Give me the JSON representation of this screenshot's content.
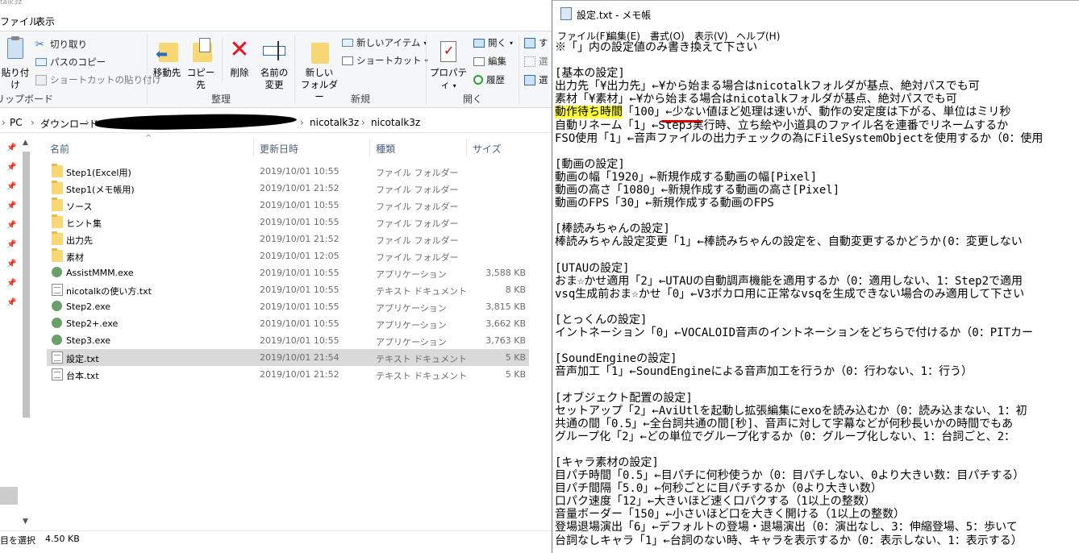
{
  "explorer": {
    "title_fragment": "talk3z",
    "tabs": [
      "ファイル",
      "表示"
    ],
    "ribbon": {
      "clipboard": {
        "pin_label": "貼り付け",
        "cut": "切り取り",
        "copy_path": "パスのコピー",
        "paste_shortcut": "ショートカットの貼り付け",
        "group": "リップボード"
      },
      "organize": {
        "move_to": "移動先",
        "copy_to": "コピー先",
        "delete": "削除",
        "rename_line1": "名前の",
        "rename_line2": "変更",
        "group": "整理"
      },
      "new": {
        "new_folder_line1": "新しい",
        "new_folder_line2": "フォルダー",
        "new_item": "新しいアイテム",
        "shortcut": "ショートカット",
        "group": "新規"
      },
      "open": {
        "properties": "プロパティ",
        "open": "開く",
        "edit": "編集",
        "history": "履歴",
        "group": "開く"
      },
      "select": {
        "sel1": "す",
        "sel2": "選",
        "sel3": "選"
      }
    },
    "breadcrumb": [
      "PC",
      "ダウンロード",
      "nicotalk3z",
      "nicotalk3z"
    ],
    "columns": {
      "name": "名前",
      "date": "更新日時",
      "type": "種類",
      "size": "サイズ"
    },
    "files": [
      {
        "name": "Step1(Excel用)",
        "date": "2019/10/01 10:55",
        "type": "ファイル フォルダー",
        "size": "",
        "icon": "folder-icon"
      },
      {
        "name": "Step1(メモ帳用)",
        "date": "2019/10/01 21:52",
        "type": "ファイル フォルダー",
        "size": "",
        "icon": "folder-icon"
      },
      {
        "name": "ソース",
        "date": "2019/10/01 10:55",
        "type": "ファイル フォルダー",
        "size": "",
        "icon": "folder-icon"
      },
      {
        "name": "ヒント集",
        "date": "2019/10/01 10:55",
        "type": "ファイル フォルダー",
        "size": "",
        "icon": "folder-icon"
      },
      {
        "name": "出力先",
        "date": "2019/10/01 21:52",
        "type": "ファイル フォルダー",
        "size": "",
        "icon": "folder-icon"
      },
      {
        "name": "素材",
        "date": "2019/10/01 12:05",
        "type": "ファイル フォルダー",
        "size": "",
        "icon": "folder-icon"
      },
      {
        "name": "AssistMMM.exe",
        "date": "2019/10/01 10:55",
        "type": "アプリケーション",
        "size": "3,588 KB",
        "icon": "app-icon"
      },
      {
        "name": "nicotalkの使い方.txt",
        "date": "2019/10/01 10:55",
        "type": "テキスト ドキュメント",
        "size": "8 KB",
        "icon": "text-file-icon"
      },
      {
        "name": "Step2.exe",
        "date": "2019/10/01 10:55",
        "type": "アプリケーション",
        "size": "3,815 KB",
        "icon": "app-icon"
      },
      {
        "name": "Step2+.exe",
        "date": "2019/10/01 10:55",
        "type": "アプリケーション",
        "size": "3,662 KB",
        "icon": "app-icon"
      },
      {
        "name": "Step3.exe",
        "date": "2019/10/01 10:55",
        "type": "アプリケーション",
        "size": "3,763 KB",
        "icon": "app-icon"
      },
      {
        "name": "設定.txt",
        "date": "2019/10/01 21:54",
        "type": "テキスト ドキュメント",
        "size": "5 KB",
        "icon": "text-file-icon",
        "selected": true
      },
      {
        "name": "台本.txt",
        "date": "2019/10/01 21:52",
        "type": "テキスト ドキュメント",
        "size": "5 KB",
        "icon": "text-file-icon"
      }
    ],
    "status": {
      "selected": "目を選択",
      "size": "4.50 KB"
    }
  },
  "notepad": {
    "title": "設定.txt - メモ帳",
    "menu": [
      "ファイル(F)",
      "編集(E)",
      "書式(O)",
      "表示(V)",
      "ヘルプ(H)"
    ],
    "highlight_text": "動作待ち時間",
    "lines": [
      "※「」内の設定値のみ書き換えて下さい",
      "",
      "[基本の設定]",
      "出力先「¥出力先」←¥から始まる場合はnicotalkフォルダが基点、絶対パスでも可",
      "素材「¥素材」←¥から始まる場合はnicotalkフォルダが基点、絶対パスでも可",
      "「100」←少ない値ほど処理は速いが、動作の安定度は下がる、単位はミリ秒",
      "自動リネーム「1」←Step3実行時、立ち絵や小道具のファイル名を連番でリネームするか",
      "FSO使用「1」←音声ファイルの出力チェックの為にFileSystemObjectを使用するか（0：使用",
      "",
      "[動画の設定]",
      "動画の幅「1920」←新規作成する動画の幅[Pixel]",
      "動画の高さ「1080」←新規作成する動画の高さ[Pixel]",
      "動画のFPS「30」←新規作成する動画のFPS",
      "",
      "[棒読みちゃんの設定]",
      "棒読みちゃん設定変更「1」←棒読みちゃんの設定を、自動変更するかどうか(0：変更しない",
      "",
      "[UTAUの設定]",
      "おま☆かせ適用「2」←UTAUの自動調声機能を適用するか（0：適用しない、1：Step2で適用",
      "vsq生成前おま☆かせ「0」←V3ボカロ用に正常なvsqを生成できない場合のみ適用して下さい",
      "",
      "[とっくんの設定]",
      "イントネーション「0」←VOCALOID音声のイントネーションをどちらで付けるか（0：PITカー",
      "",
      "[SoundEngineの設定]",
      "音声加工「1」←SoundEngineによる音声加工を行うか（0：行わない、1：行う）",
      "",
      "[オブジェクト配置の設定]",
      "セットアップ「2」←AviUtlを起動し拡張編集にexoを読み込むか（0：読み込まない、1：初",
      "共通の間「0.5」←全台詞共通の間[秒]、音声に対して字幕などが何秒長いかの時間でもあ",
      "グループ化「2」←どの単位でグループ化するか（0：グループ化しない、1：台詞ごと、2：",
      "",
      "[キャラ素材の設定]",
      "目パチ時間「0.5」←目パチに何秒使うか（0：目パチしない、0より大きい数：目パチする）",
      "目パチ間隔「5.0」←何秒ごとに目パチするか（0より大きい数）",
      "口パク速度「12」←大きいほど速く口パクする（1以上の整数）",
      "音量ボーダー「150」←小さいほど口を大きく開ける（1以上の整数）",
      "登場退場演出「6」←デフォルトの登場・退場演出（0：演出なし、3：伸縮登場、5：歩いて",
      "台詞なしキャラ「1」←台詞のない時、キャラを表示するか（0：表示しない、1：表示する）"
    ],
    "colors": {
      "highlight": "#ffff33",
      "underline": "#d40000"
    }
  }
}
